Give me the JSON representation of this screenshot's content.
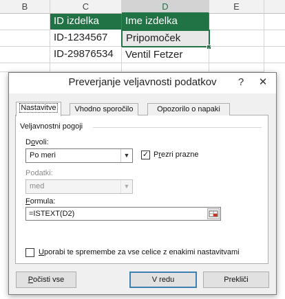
{
  "sheet": {
    "columns": [
      "B",
      "C",
      "D",
      "E"
    ],
    "selected_column": "D",
    "header_row": [
      "ID izdelka",
      "Ime izdelka"
    ],
    "rows": [
      [
        "ID-1234567",
        "Pripomoček"
      ],
      [
        "ID-29876534",
        "Ventil Fetzer"
      ]
    ],
    "colors": {
      "header_fill": "#217346",
      "header_text": "#ffffff",
      "accent": "#217346"
    }
  },
  "dialog": {
    "title": "Preverjanje veljavnosti podatkov",
    "help": "?",
    "close": "✕",
    "tabs": [
      {
        "label": "Nastavitve",
        "active": true
      },
      {
        "label": "Vhodno sporočilo",
        "active": false
      },
      {
        "label": "Opozorilo o napaki",
        "active": false
      }
    ],
    "group_title": "Veljavnostni pogoji",
    "allow": {
      "label_pre": "D",
      "label_u": "o",
      "label_post": "voli:",
      "value": "Po meri"
    },
    "ignore_blank": {
      "label_pre": "P",
      "label_u": "r",
      "label_post": "ezri prazne",
      "checked": true,
      "mark": "✓"
    },
    "data": {
      "label": "Podatki:",
      "value": "med",
      "enabled": false
    },
    "formula": {
      "label_u": "F",
      "label_post": "ormula:",
      "value": "=ISTEXT(D2)",
      "refedit_icon": "range-select-icon"
    },
    "apply_all": {
      "label_pre": "",
      "label_u": "U",
      "label_post": "porabi te spremembe za vse celice z enakimi nastavitvami",
      "checked": false
    },
    "buttons": {
      "clear_u": "P",
      "clear_post": "očisti vse",
      "ok": "V redu",
      "cancel": "Prekliči"
    },
    "colors": {
      "default_button_border": "#3c7fb1",
      "panel_bg": "#ffffff",
      "dialog_bg": "#f0f0f0"
    }
  }
}
